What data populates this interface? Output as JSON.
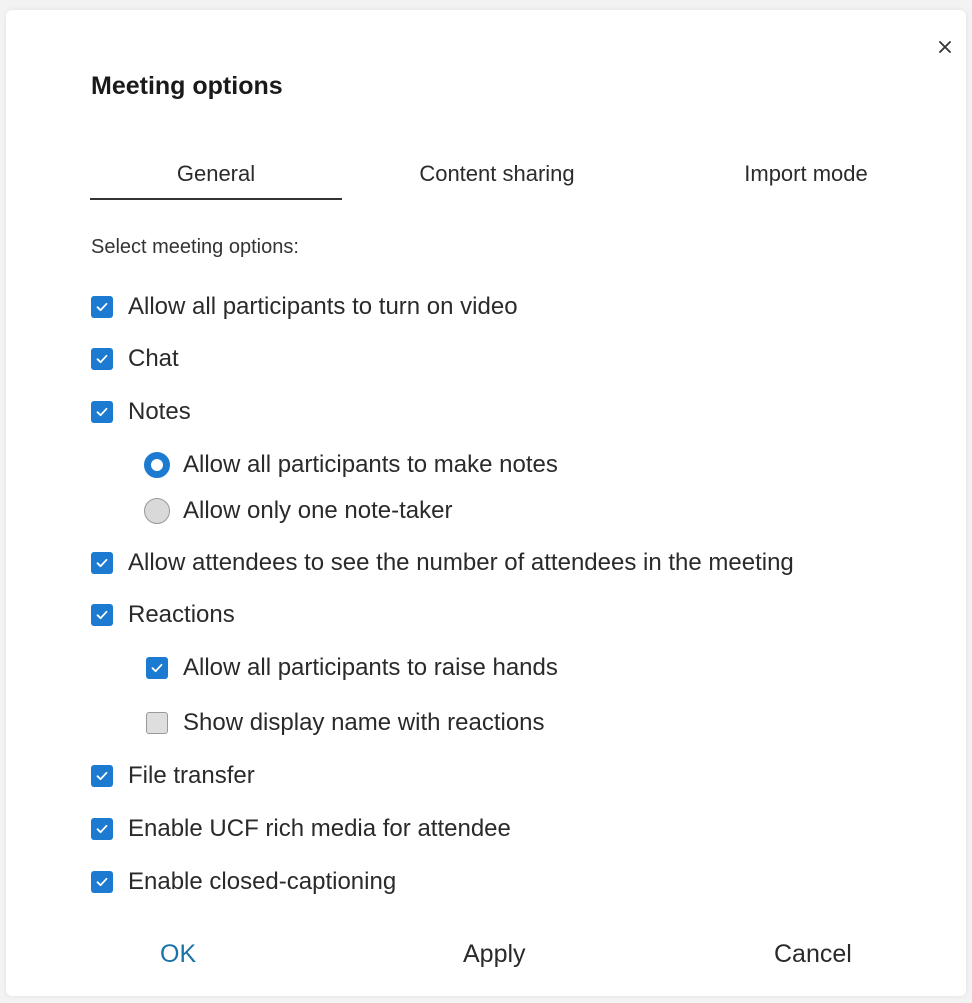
{
  "dialog": {
    "title": "Meeting options",
    "close_icon": "close-icon"
  },
  "tabs": [
    {
      "label": "General",
      "selected": true
    },
    {
      "label": "Content sharing",
      "selected": false
    },
    {
      "label": "Import mode",
      "selected": false
    }
  ],
  "general": {
    "subheading": "Select meeting options:",
    "options": {
      "video": {
        "label": "Allow all participants to turn on video",
        "checked": true
      },
      "chat": {
        "label": "Chat",
        "checked": true
      },
      "notes": {
        "label": "Notes",
        "checked": true
      },
      "notes_all": {
        "label": "Allow all participants to make notes",
        "selected": true
      },
      "notes_one": {
        "label": "Allow only one note-taker",
        "selected": false
      },
      "attendee_count": {
        "label": "Allow attendees to see the number of attendees in the meeting",
        "checked": true
      },
      "reactions": {
        "label": "Reactions",
        "checked": true
      },
      "raise_hands": {
        "label": "Allow all participants to raise hands",
        "checked": true
      },
      "display_name": {
        "label": "Show display name with reactions",
        "checked": false
      },
      "file_transfer": {
        "label": "File transfer",
        "checked": true
      },
      "ucf": {
        "label": "Enable UCF rich media for attendee",
        "checked": true
      },
      "captioning": {
        "label": "Enable closed-captioning",
        "checked": true
      }
    }
  },
  "footer": {
    "ok_label": "OK",
    "apply_label": "Apply",
    "cancel_label": "Cancel"
  },
  "colors": {
    "accent": "#1c7bd0",
    "ok_text": "#1a73a8"
  }
}
